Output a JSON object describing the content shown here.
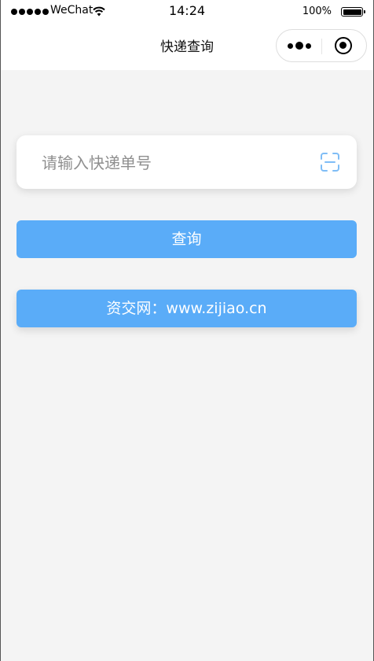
{
  "status_bar": {
    "carrier": "WeChat",
    "time": "14:24",
    "battery": "100%"
  },
  "nav": {
    "title": "快递查询"
  },
  "search": {
    "placeholder": "请输入快递单号",
    "value": ""
  },
  "buttons": {
    "query": "查询",
    "site": "资交网：www.zijiao.cn"
  },
  "colors": {
    "accent": "#5aacf8",
    "background": "#f4f4f4",
    "scan_icon": "#7fbdf6"
  },
  "icons": {
    "signal": "signal-dots-icon",
    "wifi": "wifi-icon",
    "battery": "battery-icon",
    "more": "more-dots-icon",
    "close": "target-circle-icon",
    "scan": "scan-icon"
  }
}
